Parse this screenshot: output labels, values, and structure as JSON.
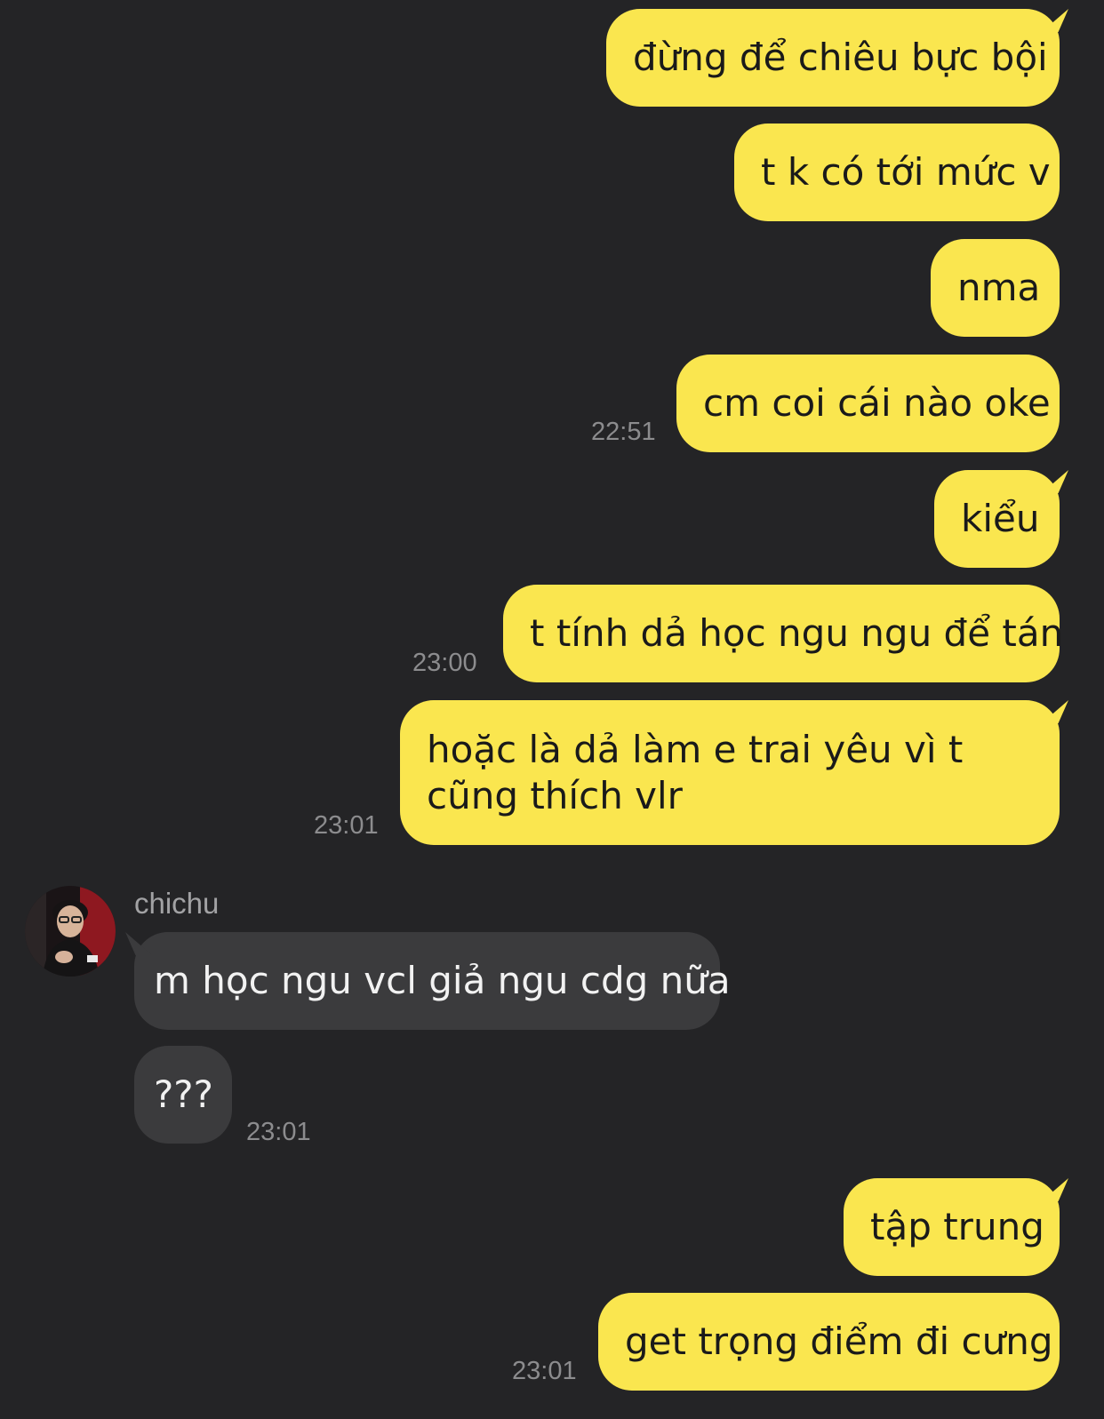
{
  "conversation": {
    "messages": [
      {
        "text": "đừng để chiêu bực bội"
      },
      {
        "text": "t k có tới mức v"
      },
      {
        "text": "nma"
      },
      {
        "text": "cm coi cái nào oke",
        "time": "22:51"
      },
      {
        "text": "kiểu"
      },
      {
        "text": "t tính dả học ngu ngu để tán",
        "time": "23:00"
      },
      {
        "text": "hoặc là dả làm e trai yêu vì t cũng thích vlr",
        "time": "23:01"
      },
      {
        "text": "m học ngu vcl giả ngu cdg nữa"
      },
      {
        "text": "???",
        "time": "23:01"
      },
      {
        "text": "tập trung"
      },
      {
        "text": "get trọng điểm đi cưng",
        "time": "23:01"
      }
    ],
    "contact": {
      "name": "chichu",
      "avatar_icon": "user-avatar-photo"
    }
  },
  "colors": {
    "background": "#242426",
    "outgoing_bubble": "#fae64f",
    "incoming_bubble": "#3b3b3d",
    "timestamp": "#8c8c8e"
  }
}
